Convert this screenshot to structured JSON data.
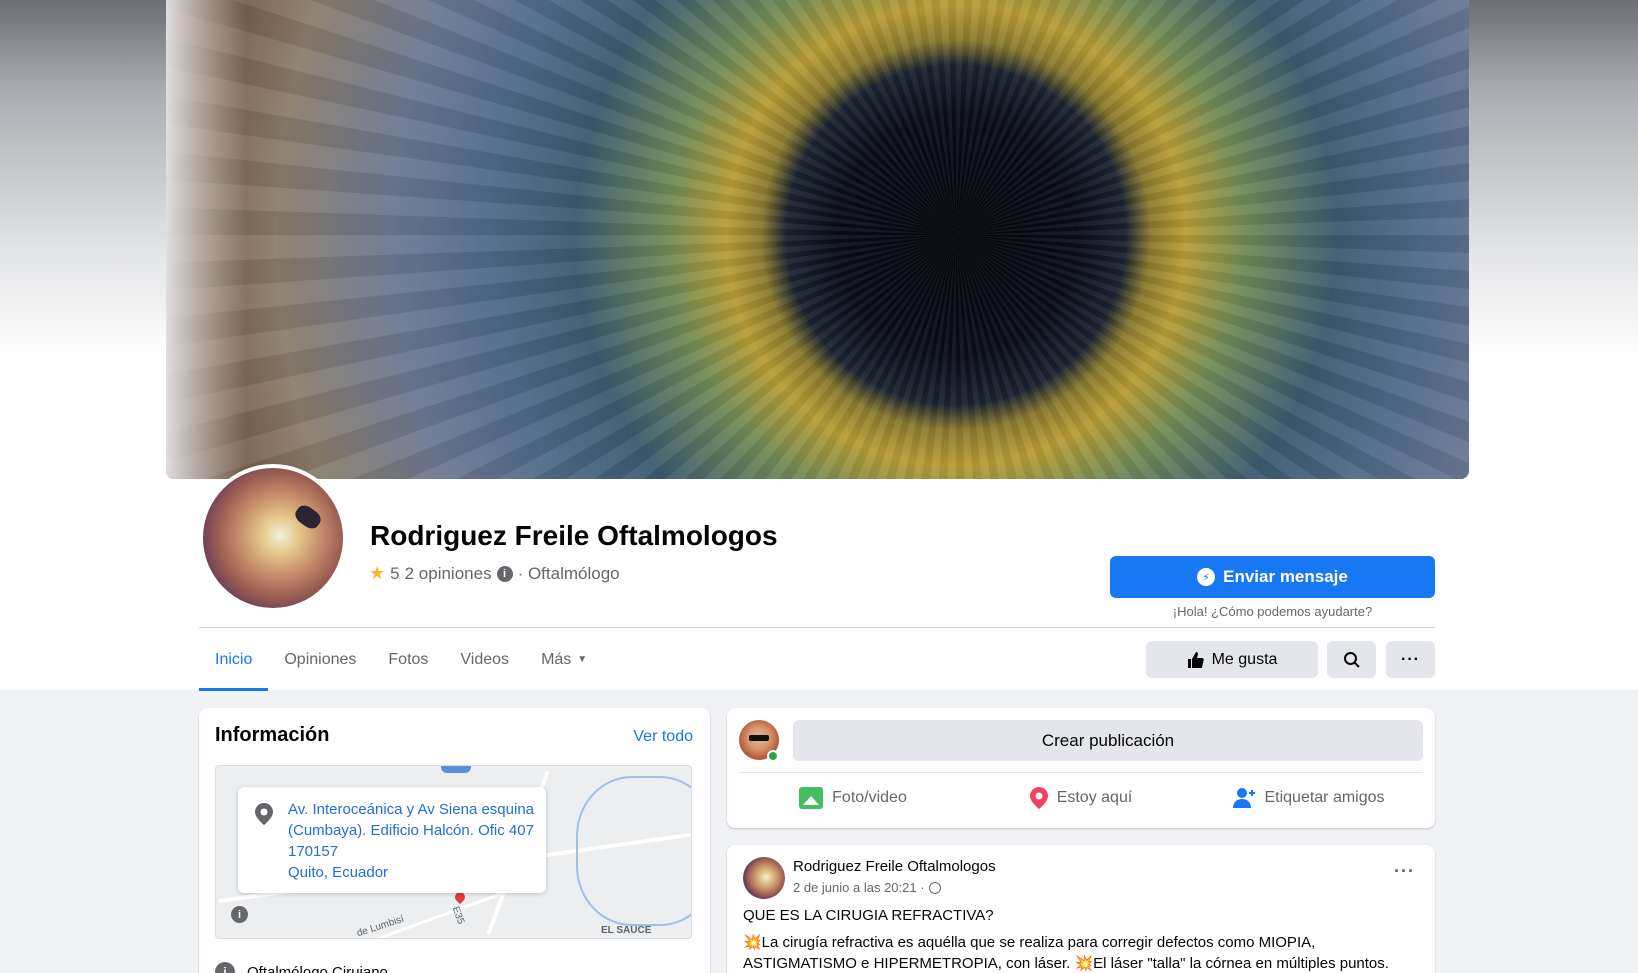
{
  "page": {
    "name": "Rodriguez Freile Oftalmologos",
    "rating": "5",
    "reviews": "2 opiniones",
    "category_suffix": "· Oftalmólogo"
  },
  "actions": {
    "message_label": "Enviar mensaje",
    "message_hint": "¡Hola! ¿Cómo podemos ayudarte?",
    "like_label": "Me gusta",
    "more_label": "···"
  },
  "tabs": [
    {
      "label": "Inicio"
    },
    {
      "label": "Opiniones"
    },
    {
      "label": "Fotos"
    },
    {
      "label": "Videos"
    },
    {
      "label": "Más"
    }
  ],
  "info": {
    "title": "Información",
    "see_all": "Ver todo",
    "address": "Av. Interoceánica y Av Siena esquina (Cumbaya). Edificio Halcón. Ofic 407 170157",
    "city": "Quito, Ecuador",
    "map_label_1": "EL SAUCE",
    "map_label_2": "de Lumbisí",
    "map_label_3": "E35",
    "category": "Oftalmólogo Cirujano"
  },
  "composer": {
    "prompt": "Crear publicación",
    "photo_label": "Foto/video",
    "checkin_label": "Estoy aquí",
    "tag_label": "Etiquetar amigos"
  },
  "post": {
    "author": "Rodriguez Freile Oftalmologos",
    "date": "2 de junio a las 20:21 ·",
    "menu": "···",
    "headline": "QUE ES LA CIRUGIA REFRACTIVA?",
    "body": "💥La cirugía refractiva es aquélla que se realiza para corregir defectos como MIOPIA, ASTIGMATISMO e HIPERMETROPIA, con láser.  💥El láser \"talla\" la córnea en múltiples puntos."
  },
  "colors": {
    "brand_blue": "#1877f2",
    "background": "#f0f2f5",
    "button_gray": "#e4e6eb",
    "secondary_text": "#65676b"
  }
}
